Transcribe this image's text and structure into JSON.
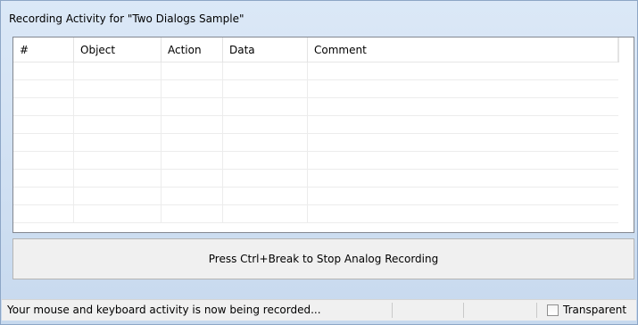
{
  "window": {
    "title": "Recording Activity for \"Two Dialogs Sample\""
  },
  "grid": {
    "columns": [
      "#",
      "Object",
      "Action",
      "Data",
      "Comment"
    ],
    "rows": []
  },
  "stop_panel": {
    "message": "Press Ctrl+Break to Stop Analog Recording"
  },
  "statusbar": {
    "message": "Your mouse and keyboard activity is now being recorded...",
    "transparent_label": "Transparent",
    "transparent_checked": false
  }
}
